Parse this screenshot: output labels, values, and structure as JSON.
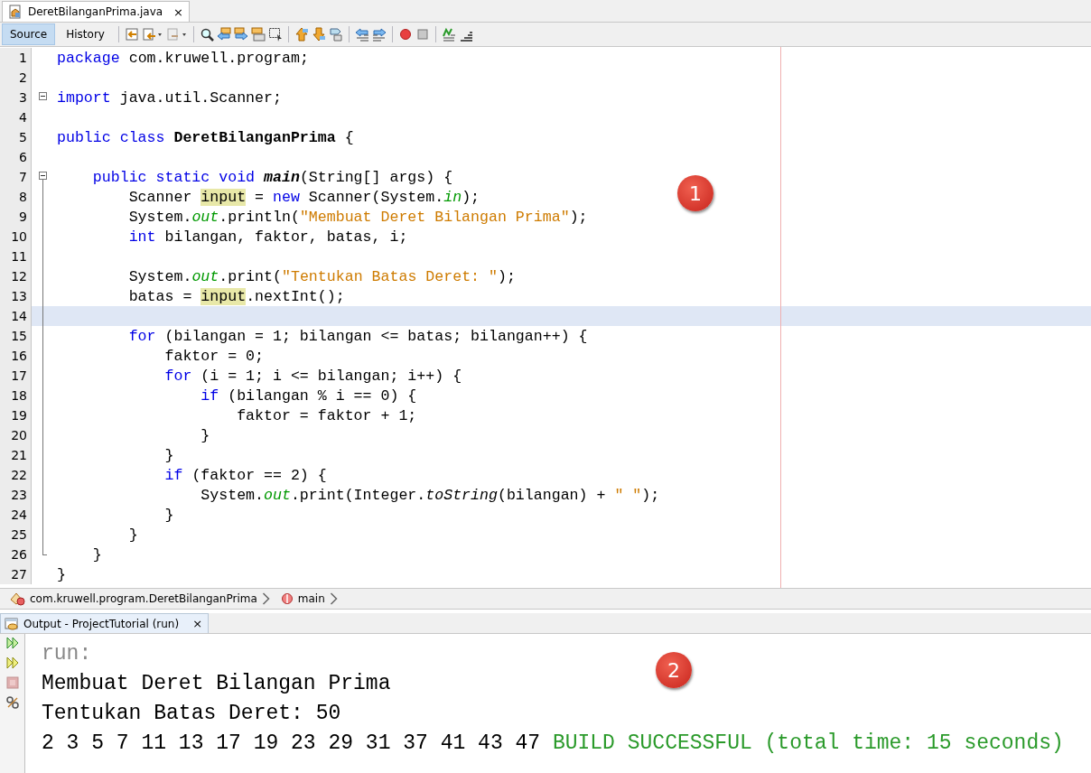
{
  "file_tab": {
    "label": "DeretBilanganPrima.java",
    "close": "×"
  },
  "view_tabs": [
    {
      "label": "Source",
      "selected": true
    },
    {
      "label": "History",
      "selected": false
    }
  ],
  "editor": {
    "lines": [
      {
        "number": "1",
        "current": false,
        "foldable": false,
        "in_fold": false,
        "tokens": [
          {
            "kind": "keyword",
            "text": "package"
          },
          {
            "kind": "plain",
            "text": " com.kruwell.program;"
          }
        ]
      },
      {
        "number": "2",
        "current": false,
        "foldable": false,
        "in_fold": false
      },
      {
        "number": "3",
        "current": false,
        "foldable": true,
        "in_fold": false,
        "tokens": [
          {
            "kind": "keyword",
            "text": "import"
          },
          {
            "kind": "plain",
            "text": " java.util.Scanner;"
          }
        ]
      },
      {
        "number": "4",
        "current": false,
        "foldable": false,
        "in_fold": false
      },
      {
        "number": "5",
        "current": false,
        "foldable": false,
        "in_fold": false,
        "tokens": [
          {
            "kind": "keyword",
            "text": "public class "
          },
          {
            "kind": "bold",
            "text": "DeretBilanganPrima"
          },
          {
            "kind": "plain",
            "text": " {"
          }
        ]
      },
      {
        "number": "6",
        "current": false,
        "foldable": false,
        "in_fold": false
      },
      {
        "number": "7",
        "current": false,
        "foldable": true,
        "in_fold": false,
        "tokens": [
          {
            "kind": "keyword",
            "text": "    public static void "
          },
          {
            "kind": "bold-italic",
            "text": "main"
          },
          {
            "kind": "plain",
            "text": "(String[] args) {"
          }
        ]
      },
      {
        "number": "8",
        "current": false,
        "foldable": false,
        "in_fold": true,
        "tokens": [
          {
            "kind": "plain",
            "text": "        Scanner "
          },
          {
            "kind": "mark",
            "text": "input"
          },
          {
            "kind": "plain",
            "text": " = "
          },
          {
            "kind": "keyword",
            "text": "new"
          },
          {
            "kind": "plain",
            "text": " Scanner(System."
          },
          {
            "kind": "field",
            "text": "in"
          },
          {
            "kind": "plain",
            "text": ");"
          }
        ]
      },
      {
        "number": "9",
        "current": false,
        "foldable": false,
        "in_fold": true,
        "tokens": [
          {
            "kind": "plain",
            "text": "        System."
          },
          {
            "kind": "field",
            "text": "out"
          },
          {
            "kind": "plain",
            "text": ".println("
          },
          {
            "kind": "string",
            "text": "\"Membuat Deret Bilangan Prima\""
          },
          {
            "kind": "plain",
            "text": ");"
          }
        ]
      },
      {
        "number": "10",
        "current": false,
        "foldable": false,
        "in_fold": true,
        "tokens": [
          {
            "kind": "keyword",
            "text": "        int"
          },
          {
            "kind": "plain",
            "text": " bilangan, faktor, batas, i;"
          }
        ]
      },
      {
        "number": "11",
        "current": false,
        "foldable": false,
        "in_fold": true
      },
      {
        "number": "12",
        "current": false,
        "foldable": false,
        "in_fold": true,
        "tokens": [
          {
            "kind": "plain",
            "text": "        System."
          },
          {
            "kind": "field",
            "text": "out"
          },
          {
            "kind": "plain",
            "text": ".print("
          },
          {
            "kind": "string",
            "text": "\"Tentukan Batas Deret: \""
          },
          {
            "kind": "plain",
            "text": ");"
          }
        ]
      },
      {
        "number": "13",
        "current": false,
        "foldable": false,
        "in_fold": true,
        "tokens": [
          {
            "kind": "plain",
            "text": "        batas = "
          },
          {
            "kind": "mark",
            "text": "input"
          },
          {
            "kind": "plain",
            "text": ".nextInt();"
          }
        ]
      },
      {
        "number": "14",
        "current": true,
        "foldable": false,
        "in_fold": true
      },
      {
        "number": "15",
        "current": false,
        "foldable": false,
        "in_fold": true,
        "tokens": [
          {
            "kind": "keyword",
            "text": "        for"
          },
          {
            "kind": "plain",
            "text": " (bilangan = 1; bilangan <= batas; bilangan++) {"
          }
        ]
      },
      {
        "number": "16",
        "current": false,
        "foldable": false,
        "in_fold": true,
        "tokens": [
          {
            "kind": "plain",
            "text": "            faktor = 0;"
          }
        ]
      },
      {
        "number": "17",
        "current": false,
        "foldable": false,
        "in_fold": true,
        "tokens": [
          {
            "kind": "keyword",
            "text": "            for"
          },
          {
            "kind": "plain",
            "text": " (i = 1; i <= bilangan; i++) {"
          }
        ]
      },
      {
        "number": "18",
        "current": false,
        "foldable": false,
        "in_fold": true,
        "tokens": [
          {
            "kind": "keyword",
            "text": "                if"
          },
          {
            "kind": "plain",
            "text": " (bilangan % i == 0) {"
          }
        ]
      },
      {
        "number": "19",
        "current": false,
        "foldable": false,
        "in_fold": true,
        "tokens": [
          {
            "kind": "plain",
            "text": "                    faktor = faktor + 1;"
          }
        ]
      },
      {
        "number": "20",
        "current": false,
        "foldable": false,
        "in_fold": true,
        "tokens": [
          {
            "kind": "plain",
            "text": "                }"
          }
        ]
      },
      {
        "number": "21",
        "current": false,
        "foldable": false,
        "in_fold": true,
        "tokens": [
          {
            "kind": "plain",
            "text": "            }"
          }
        ]
      },
      {
        "number": "22",
        "current": false,
        "foldable": false,
        "in_fold": true,
        "tokens": [
          {
            "kind": "keyword",
            "text": "            if"
          },
          {
            "kind": "plain",
            "text": " (faktor == 2) {"
          }
        ]
      },
      {
        "number": "23",
        "current": false,
        "foldable": false,
        "in_fold": true,
        "tokens": [
          {
            "kind": "plain",
            "text": "                System."
          },
          {
            "kind": "field",
            "text": "out"
          },
          {
            "kind": "plain",
            "text": ".print(Integer."
          },
          {
            "kind": "italic",
            "text": "toString"
          },
          {
            "kind": "plain",
            "text": "(bilangan) + "
          },
          {
            "kind": "string",
            "text": "\" \""
          },
          {
            "kind": "plain",
            "text": ");"
          }
        ]
      },
      {
        "number": "24",
        "current": false,
        "foldable": false,
        "in_fold": true,
        "tokens": [
          {
            "kind": "plain",
            "text": "            }"
          }
        ]
      },
      {
        "number": "25",
        "current": false,
        "foldable": false,
        "in_fold": true,
        "tokens": [
          {
            "kind": "plain",
            "text": "        }"
          }
        ]
      },
      {
        "number": "26",
        "current": false,
        "foldable": false,
        "in_fold": true,
        "tokens": [
          {
            "kind": "plain",
            "text": "    }"
          }
        ]
      },
      {
        "number": "27",
        "current": false,
        "foldable": false,
        "in_fold": false,
        "tokens": [
          {
            "kind": "plain",
            "text": "}"
          }
        ]
      }
    ],
    "badge": "1"
  },
  "breadcrumbs": [
    {
      "kind": "class",
      "label": "com.kruwell.program.DeretBilanganPrima"
    },
    {
      "kind": "method",
      "label": "main"
    }
  ],
  "output": {
    "tab": {
      "label": "Output - ProjectTutorial (run)",
      "close": "×"
    },
    "badge": "2",
    "lines": [
      [
        {
          "kind": "muted",
          "text": "run:"
        }
      ],
      [
        {
          "kind": "normal",
          "text": "Membuat Deret Bilangan Prima"
        }
      ],
      [
        {
          "kind": "normal",
          "text": "Tentukan Batas Deret: 50"
        }
      ],
      [
        {
          "kind": "normal",
          "text": "2 3 5 7 11 13 17 19 23 29 31 37 41 43 47 "
        },
        {
          "kind": "success",
          "text": "BUILD SUCCESSFUL (total time: 15 seconds)"
        }
      ]
    ]
  }
}
